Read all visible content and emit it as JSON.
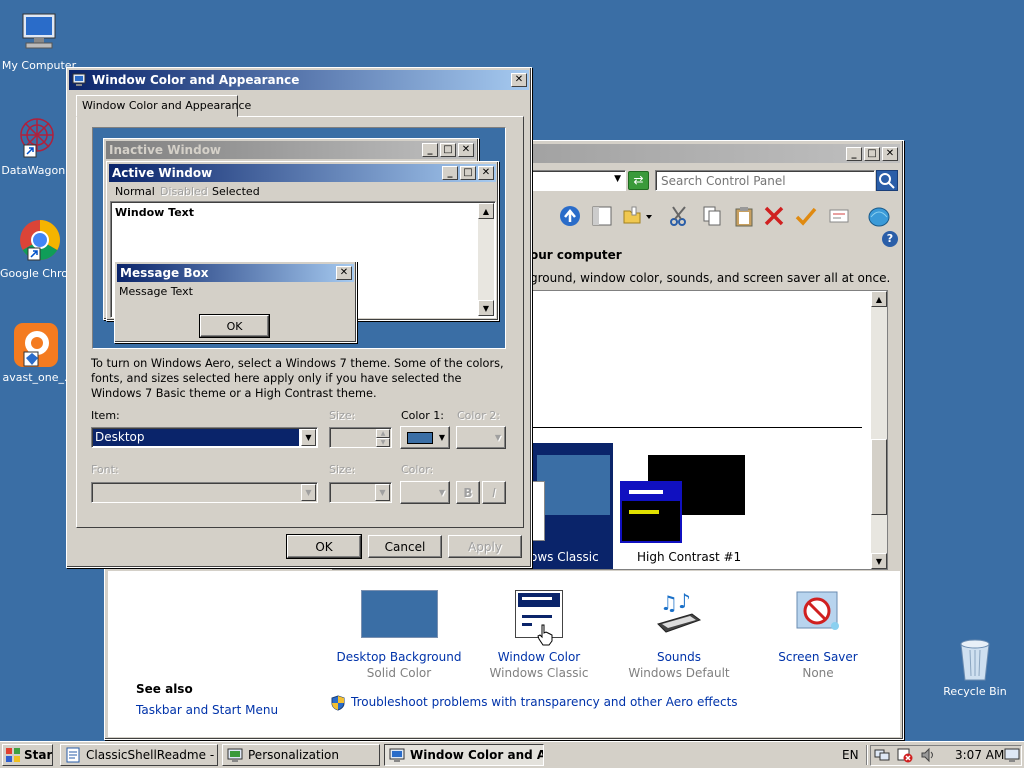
{
  "desktop": {
    "icons": [
      {
        "label": "My Computer"
      },
      {
        "label": "DataWagon."
      },
      {
        "label": "Google Chrom"
      },
      {
        "label": "avast_one_."
      },
      {
        "label": "Recycle Bin"
      }
    ]
  },
  "personalization": {
    "search_placeholder": "Search Control Panel",
    "heading": "our computer",
    "subheading": "ground, window color, sounds, and screen saver all at once.",
    "themes": [
      {
        "label": "ows Classic"
      },
      {
        "label": "High Contrast #1"
      }
    ],
    "items": [
      {
        "label": "Desktop Background",
        "sub": "Solid Color"
      },
      {
        "label": "Window Color",
        "sub": "Windows Classic"
      },
      {
        "label": "Sounds",
        "sub": "Windows Default"
      },
      {
        "label": "Screen Saver",
        "sub": "None"
      }
    ],
    "see_also": "See also",
    "taskbar_link": "Taskbar and Start Menu",
    "troubleshoot_link": "Troubleshoot problems with transparency and other Aero effects"
  },
  "dialog": {
    "title": "Window Color and Appearance",
    "tab": "Window Color and Appearance",
    "preview": {
      "inactive_title": "Inactive Window",
      "active_title": "Active Window",
      "menu_normal": "Normal",
      "menu_disabled": "Disabled",
      "menu_selected": "Selected",
      "window_text": "Window Text",
      "msgbox_title": "Message Box",
      "msgbox_text": "Message Text",
      "msgbox_ok": "OK"
    },
    "info_text": "To turn on Windows Aero, select a Windows 7 theme.  Some of the colors, fonts, and sizes selected here apply only if you have selected the Windows 7 Basic theme or a High Contrast theme.",
    "item_label": "Item:",
    "item_value": "Desktop",
    "size_label": "Size:",
    "color1_label": "Color 1:",
    "color2_label": "Color 2:",
    "font_label": "Font:",
    "font_size_label": "Size:",
    "font_color_label": "Color:",
    "bold_label": "B",
    "italic_label": "I",
    "ok": "OK",
    "cancel": "Cancel",
    "apply": "Apply",
    "color1_swatch": "#3a6ea5"
  },
  "taskbar": {
    "start": "Start",
    "buttons": [
      {
        "label": "ClassicShellReadme - Wo..."
      },
      {
        "label": "Personalization"
      },
      {
        "label": "Window Color and Ap..."
      }
    ],
    "lang": "EN",
    "clock": "3:07 AM"
  },
  "colors": {
    "desktop": "#3a6ea5",
    "face": "#d4d0c8",
    "active_title_start": "#0a246a",
    "active_title_end": "#a6caf0",
    "link": "#0033aa"
  }
}
